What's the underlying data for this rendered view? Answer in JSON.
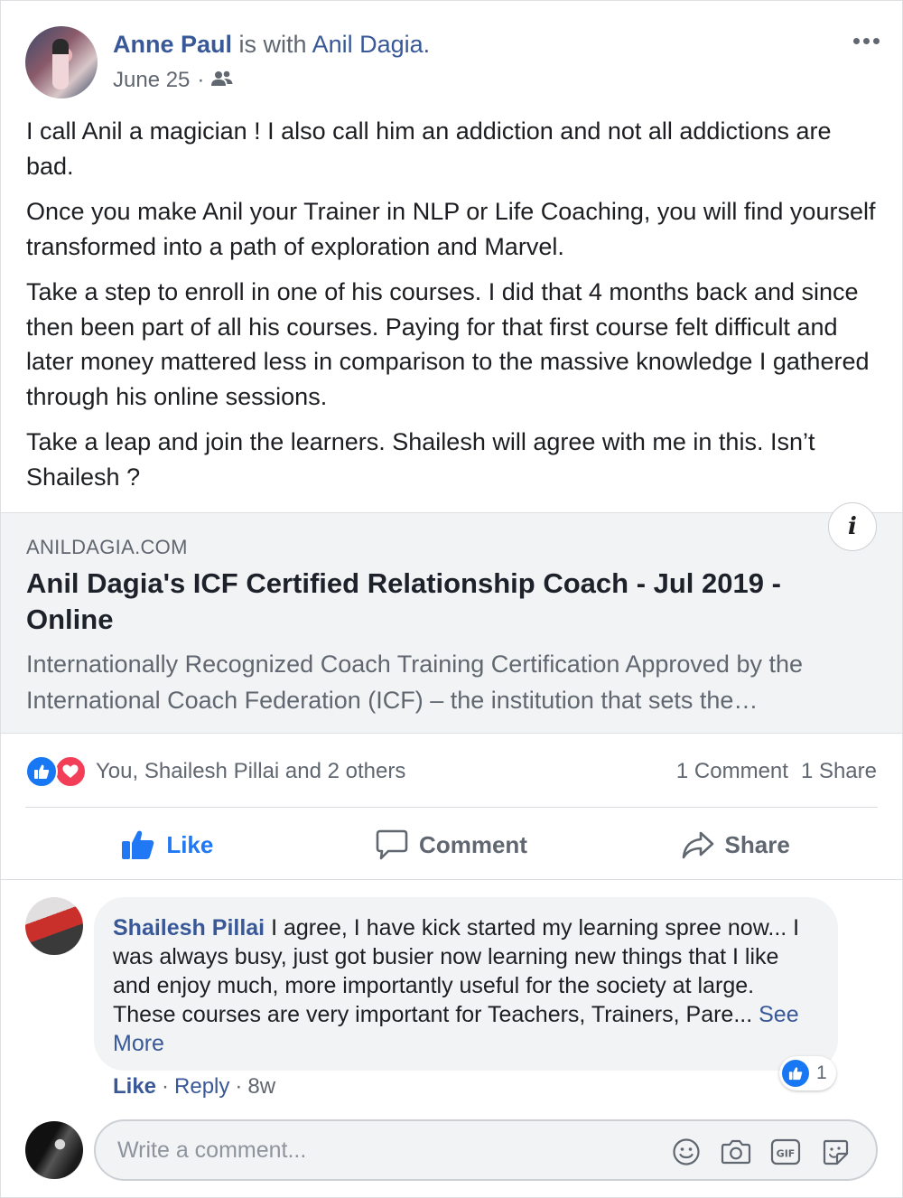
{
  "post": {
    "author": "Anne Paul",
    "with_text": " is with ",
    "tagged": "Anil Dagia.",
    "date": "June 25",
    "date_sep": "·",
    "paragraphs": [
      "I call Anil a magician ! I also call him an addiction and not all addictions are bad.",
      "Once you make Anil your Trainer in NLP or Life Coaching, you will find yourself transformed into a path of exploration and Marvel.",
      "Take a step to enroll in one of his courses. I did that 4 months back and since then been part of all his courses. Paying for that first course felt difficult and later money mattered less in comparison to the massive knowledge I gathered through his online sessions.",
      "Take a leap and join the learners. Shailesh will agree with me in this. Isn’t Shailesh ?"
    ]
  },
  "link_preview": {
    "domain": "ANILDAGIA.COM",
    "title": "Anil Dagia's ICF Certified Relationship Coach - Jul 2019 - Online",
    "description": "Internationally Recognized Coach Training Certification Approved by the International Coach Federation (ICF) – the institution that sets the…",
    "info_label": "i"
  },
  "stats": {
    "reactions_text": "You, Shailesh Pillai and 2 others",
    "comments": "1 Comment",
    "shares": "1 Share"
  },
  "actions": {
    "like": "Like",
    "comment": "Comment",
    "share": "Share"
  },
  "comment": {
    "author": "Shailesh Pillai",
    "text": " I agree, I have kick started my learning spree now... I was always busy, just got busier now learning new things that I like and enjoy much, more importantly useful for the society at large. These courses are very important for Teachers, Trainers, Pare... ",
    "see_more": "See More",
    "reaction_count": "1",
    "like": "Like",
    "sep": "·",
    "reply": "Reply",
    "time": "8w"
  },
  "composer": {
    "placeholder": "Write a comment...",
    "tools": [
      "emoji-icon",
      "camera-icon",
      "gif-icon",
      "sticker-icon"
    ]
  },
  "colors": {
    "link_blue": "#385898",
    "like_blue": "#2078f4",
    "love_red": "#f33e58",
    "muted": "#606770",
    "preview_bg": "#f2f3f5"
  }
}
